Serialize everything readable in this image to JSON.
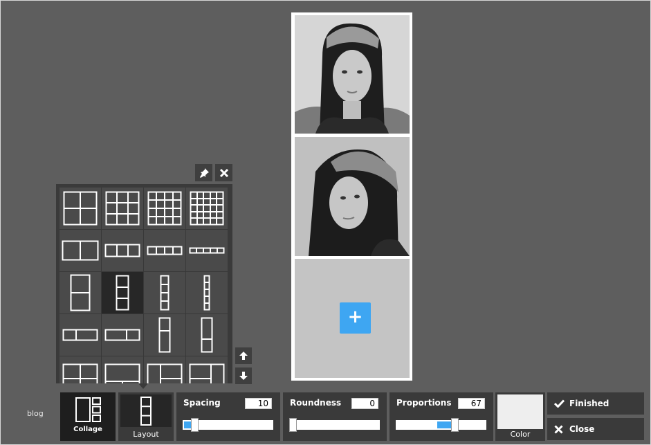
{
  "side_label": "blog",
  "canvas": {
    "add_button_label": "+"
  },
  "toolbar": {
    "collage_label": "Collage",
    "layout_label": "Layout",
    "spacing": {
      "label": "Spacing",
      "value": "10",
      "level": 0.1
    },
    "roundness": {
      "label": "Roundness",
      "value": "0",
      "level": 0
    },
    "proportions": {
      "label": "Proportions",
      "value": "67",
      "level": 0.67
    },
    "color_label": "Color",
    "color_value": "#eeeeee",
    "finished_label": "Finished",
    "close_label": "Close"
  },
  "layout_popup": {
    "pin_icon": "pin-icon",
    "close_icon": "close-icon",
    "selected_layout": "3-vertical",
    "layouts": [
      "2x2-grid",
      "3x3-grid",
      "4x4-grid",
      "5x5-grid",
      "2-horizontal",
      "3-horizontal",
      "4-horizontal",
      "5-horizontal",
      "2-vertical",
      "3-vertical",
      "4-vertical",
      "5-vertical",
      "2-horizontal-wide",
      "2-horizontal-wide-alt",
      "2-vertical-tall",
      "2-vertical-tall-alt",
      "mixed-a",
      "mixed-b",
      "mixed-c",
      "mixed-d"
    ]
  },
  "colors": {
    "accent": "#3ea6f2",
    "background": "#5e5e5e",
    "panel": "#3a3a3a"
  }
}
